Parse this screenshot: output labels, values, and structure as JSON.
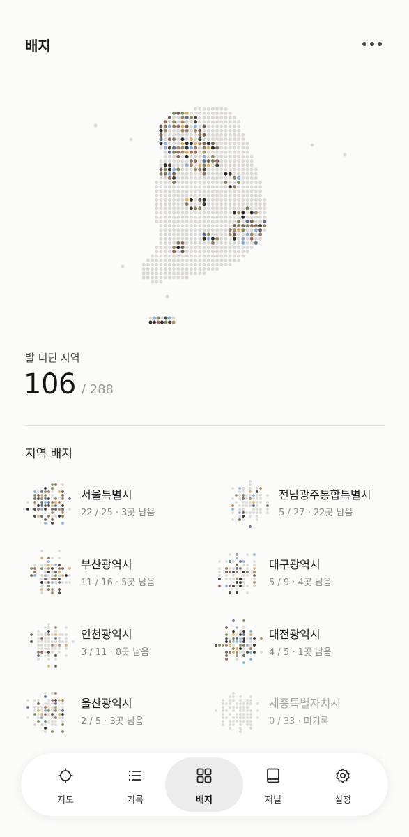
{
  "header": {
    "title": "배지",
    "more_icon": "more-horizontal-icon"
  },
  "summary": {
    "label": "발 디딘 지역",
    "visited": "106",
    "total": "/ 288"
  },
  "badges_section": {
    "title": "지역 배지",
    "items": [
      {
        "name": "서울특별시",
        "detail": "22 / 25 · 3곳 남음",
        "visited": 22,
        "total": 25,
        "dimmed": false
      },
      {
        "name": "전남광주통합특별시",
        "detail": "5 / 27 · 22곳 남음",
        "visited": 5,
        "total": 27,
        "dimmed": false
      },
      {
        "name": "부산광역시",
        "detail": "11 / 16 · 5곳 남음",
        "visited": 11,
        "total": 16,
        "dimmed": false
      },
      {
        "name": "대구광역시",
        "detail": "5 / 9 · 4곳 남음",
        "visited": 5,
        "total": 9,
        "dimmed": false
      },
      {
        "name": "인천광역시",
        "detail": "3 / 11 · 8곳 남음",
        "visited": 3,
        "total": 11,
        "dimmed": false
      },
      {
        "name": "대전광역시",
        "detail": "4 / 5 · 1곳 남음",
        "visited": 4,
        "total": 5,
        "dimmed": false
      },
      {
        "name": "울산광역시",
        "detail": "2 / 5 · 3곳 남음",
        "visited": 2,
        "total": 5,
        "dimmed": false
      },
      {
        "name": "세종특별자치시",
        "detail": "0 / 33 · 미기록",
        "visited": 0,
        "total": 33,
        "dimmed": true
      }
    ]
  },
  "nav": {
    "items": [
      {
        "label": "지도",
        "icon": "crosshair-icon",
        "active": false
      },
      {
        "label": "기록",
        "icon": "list-icon",
        "active": false
      },
      {
        "label": "배지",
        "icon": "grid-icon",
        "active": true
      },
      {
        "label": "저널",
        "icon": "book-icon",
        "active": false
      },
      {
        "label": "설정",
        "icon": "gear-icon",
        "active": false
      }
    ]
  },
  "colors": {
    "background": "#fbfbfa",
    "dot_unvisited": "#dcdad6",
    "dot_visited": [
      "#2b2b2b",
      "#4a4038",
      "#6f6253",
      "#8a7a63",
      "#a08a68",
      "#7b8a5a",
      "#5b6f8d",
      "#8fb0d9",
      "#e0b06a",
      "#9b6b5b"
    ],
    "nav_active": "#ececec"
  }
}
